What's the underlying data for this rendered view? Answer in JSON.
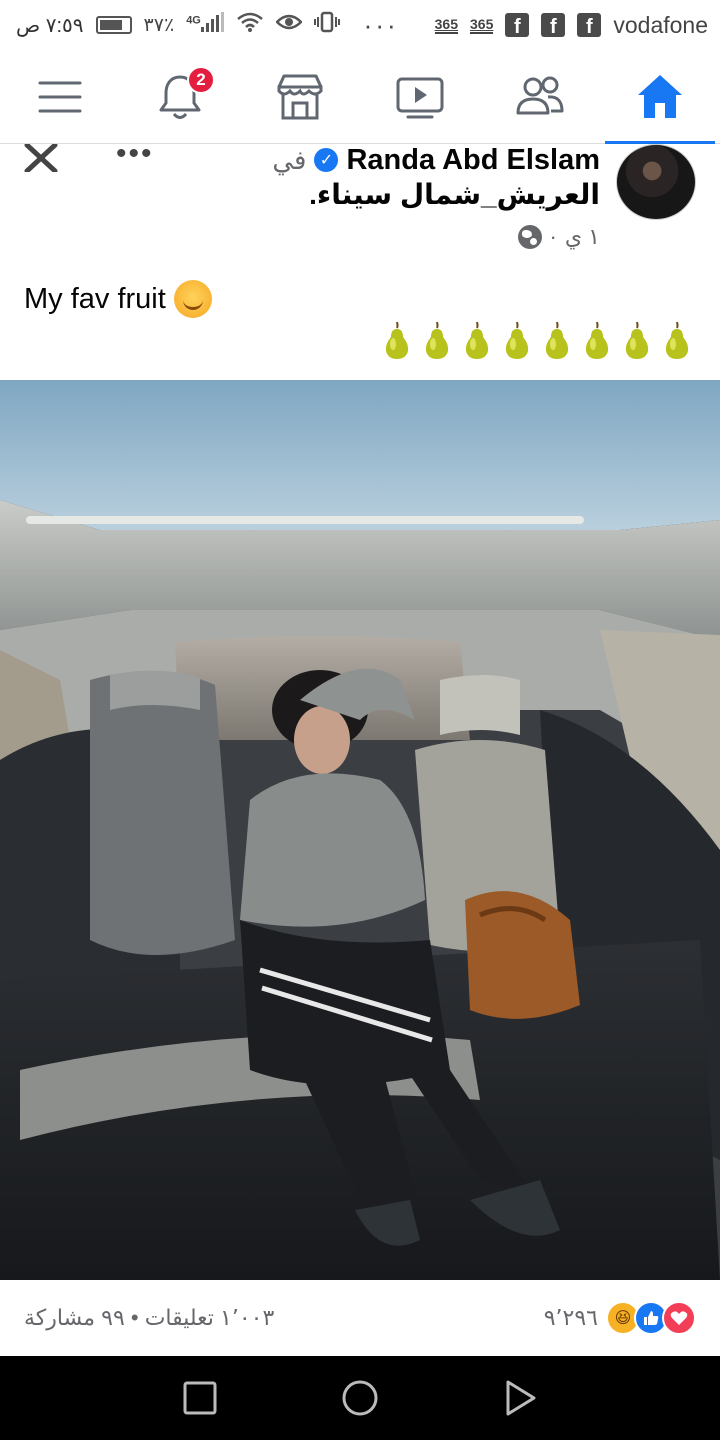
{
  "status_bar": {
    "time": "٧:٥٩ ص",
    "battery_pct": "٣٧٪",
    "network": "4G",
    "apps": [
      "365",
      "365"
    ],
    "carrier": "vodafone",
    "dots": "···"
  },
  "nav": {
    "notifications_badge": "2",
    "accent": "#1877f2",
    "items": [
      "menu-icon",
      "bell-icon",
      "marketplace-icon",
      "video-icon",
      "friends-icon",
      "home-icon"
    ]
  },
  "post": {
    "author": "Randa Abd Elslam",
    "in_word": "في",
    "location": "العريش_شمال سيناء.",
    "time": "١ ي",
    "separator": "·",
    "text": "My fav fruit",
    "pear_count": 8
  },
  "reactions": {
    "count": "٩٬٢٩٦",
    "comments": "١٬٠٠٣ تعليقات",
    "shares": "٩٩ مشاركة",
    "dot": "•"
  }
}
